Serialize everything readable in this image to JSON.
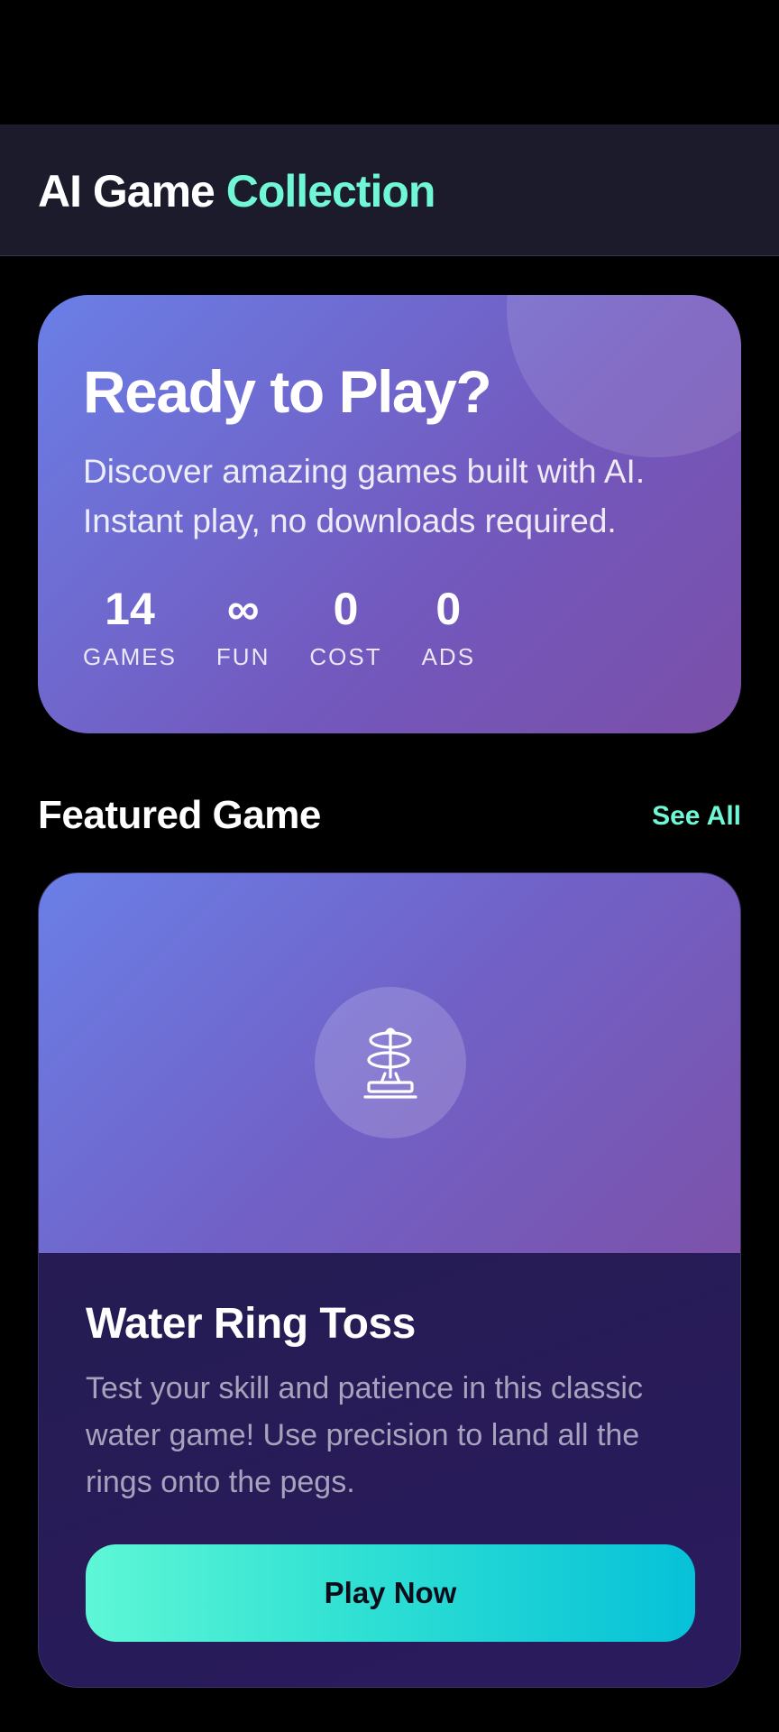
{
  "header": {
    "title_part1": "AI Game",
    "title_part2": "Collection"
  },
  "hero": {
    "title": "Ready to Play?",
    "subtitle": "Discover amazing games built with AI. Instant play, no downloads required.",
    "stats": [
      {
        "value": "14",
        "label": "GAMES"
      },
      {
        "value": "∞",
        "label": "FUN"
      },
      {
        "value": "0",
        "label": "COST"
      },
      {
        "value": "0",
        "label": "ADS"
      }
    ]
  },
  "featured": {
    "section_title": "Featured Game",
    "see_all_label": "See All",
    "game": {
      "icon": "ring-toss-icon",
      "title": "Water Ring Toss",
      "description": "Test your skill and patience in this classic water game! Use precision to land all the rings onto the pegs.",
      "play_label": "Play Now"
    }
  },
  "colors": {
    "accent": "#6ff7d6",
    "background": "#000000",
    "header_bg": "#1b1b2b",
    "hero_gradient_start": "#6a7fe6",
    "hero_gradient_end": "#7a4fa8",
    "button_gradient_start": "#5ef7d6",
    "button_gradient_end": "#06c1d8"
  }
}
